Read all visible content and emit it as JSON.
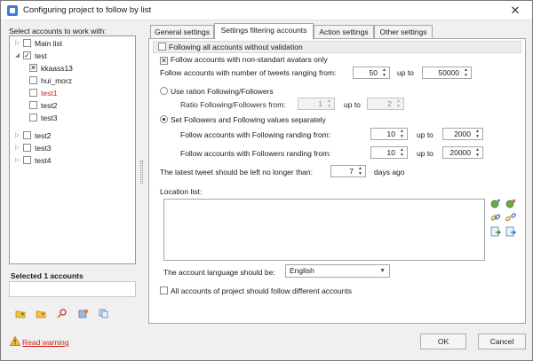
{
  "window": {
    "title": "Configuring project to follow by list",
    "close_glyph": "✕"
  },
  "left_panel": {
    "label": "Select accounts to work with:",
    "tree": [
      {
        "label": "Main list",
        "checked": false,
        "expandable": true,
        "expanded": false,
        "highlight": false
      },
      {
        "label": "test",
        "checked": true,
        "expandable": true,
        "expanded": true,
        "highlight": false
      },
      {
        "label": "kkaass13",
        "checked": true,
        "expandable": false,
        "expanded": false,
        "highlight": false
      },
      {
        "label": "hui_morz",
        "checked": false,
        "expandable": false,
        "expanded": false,
        "highlight": false
      },
      {
        "label": "test1",
        "checked": false,
        "expandable": false,
        "expanded": false,
        "highlight": true
      },
      {
        "label": "test2",
        "checked": false,
        "expandable": false,
        "expanded": false,
        "highlight": false
      },
      {
        "label": "test3",
        "checked": false,
        "expandable": false,
        "expanded": false,
        "highlight": false
      },
      {
        "label": "test2",
        "checked": false,
        "expandable": true,
        "expanded": false,
        "highlight": false
      },
      {
        "label": "test3",
        "checked": false,
        "expandable": true,
        "expanded": false,
        "highlight": false
      },
      {
        "label": "test4",
        "checked": false,
        "expandable": true,
        "expanded": false,
        "highlight": false
      }
    ],
    "selected_count_text": "Selected 1 accounts",
    "toolbar_icons": [
      "add-folder-icon",
      "remove-folder-icon",
      "search-icon",
      "settings-icon",
      "copy-icon"
    ]
  },
  "tabs": [
    {
      "label": "General settings",
      "active": false
    },
    {
      "label": "Settings filtering accounts",
      "active": true
    },
    {
      "label": "Action settings",
      "active": false
    },
    {
      "label": "Other settings",
      "active": false
    }
  ],
  "filter": {
    "follow_all_label": "Following all accounts without validation",
    "follow_all_checked": false,
    "nonstandard_avatars_label": "Follow accounts with non-standart avatars only",
    "nonstandard_avatars_checked": true,
    "tweets_range_label": "Follow accounts with number of tweets ranging from:",
    "tweets_from": "50",
    "up_to_label": "up to",
    "tweets_to": "50000",
    "ratio_radio_label": "Use ration Following/Followers",
    "ratio_radio_selected": false,
    "ratio_label": "Ratio Following/Followers from:",
    "ratio_from": "1",
    "ratio_to": "2",
    "separate_radio_label": "Set Followers and Following values separately",
    "separate_radio_selected": true,
    "following_label": "Follow accounts with Following randing from:",
    "following_from": "10",
    "following_to": "2000",
    "followers_label": "Follow accounts with Followers randing from:",
    "followers_from": "10",
    "followers_to": "20000",
    "latest_tweet_label": "The latest tweet should be left no longer than:",
    "latest_tweet_days": "7",
    "days_ago_label": "days ago",
    "location_label": "Location list:",
    "location_icons": [
      "add-location-icon",
      "remove-location-icon",
      "link-icon",
      "unlink-icon",
      "import-icon",
      "export-icon"
    ],
    "language_label": "The account language should be:",
    "language_value": "English",
    "different_accounts_label": "All accounts of project should follow different accounts",
    "different_accounts_checked": false
  },
  "footer": {
    "warning_link": "Read warning",
    "ok_label": "OK",
    "cancel_label": "Cancel"
  },
  "colors": {
    "accent": "#3a7dd8",
    "warning": "#d11a1a",
    "highlight_text": "#e01a1a"
  }
}
